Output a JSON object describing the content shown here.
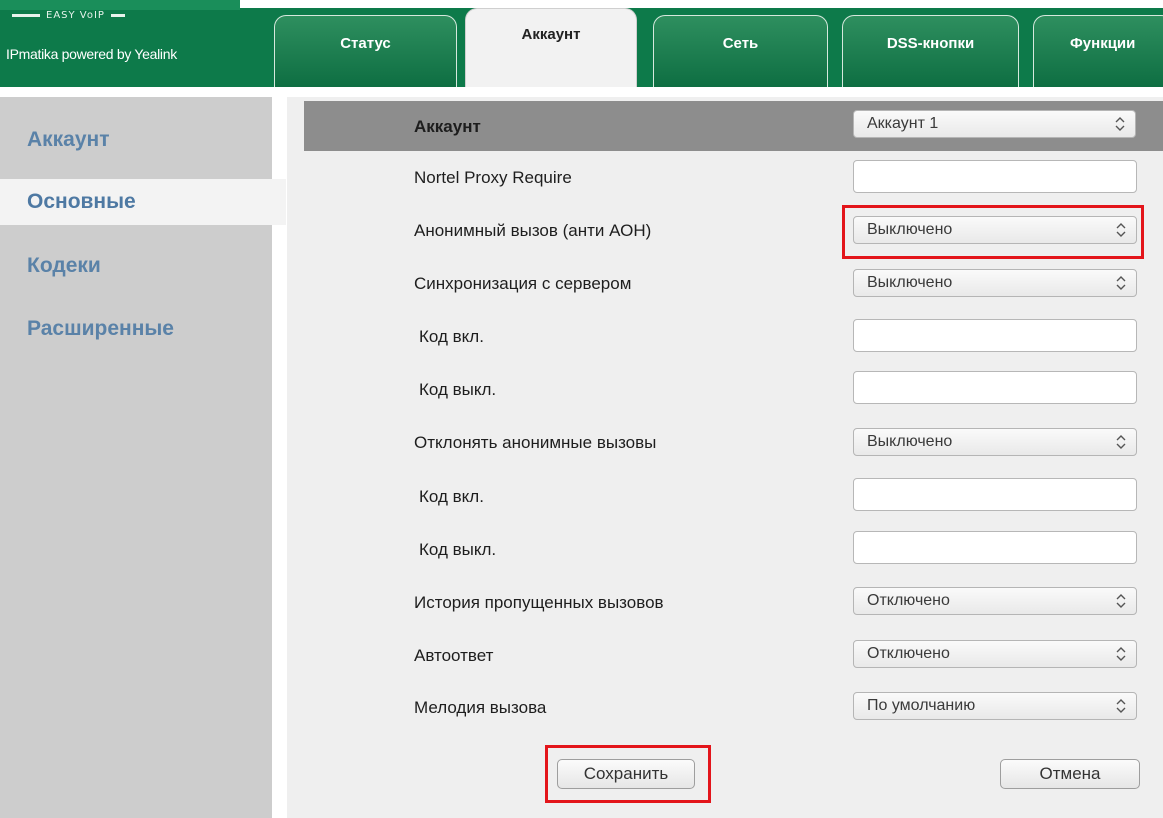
{
  "header": {
    "logo_text": "EASY VoIP",
    "brand": "IPmatika powered by Yealink",
    "tabs": [
      {
        "label": "Статус"
      },
      {
        "label": "Аккаунт"
      },
      {
        "label": "Сеть"
      },
      {
        "label": "DSS-кнопки"
      },
      {
        "label": "Функции"
      }
    ],
    "active_tab": "Аккаунт"
  },
  "sidebar": {
    "items": [
      {
        "label": "Аккаунт"
      },
      {
        "label": "Основные"
      },
      {
        "label": "Кодеки"
      },
      {
        "label": "Расширенные"
      }
    ],
    "selected": "Основные"
  },
  "form": {
    "header": {
      "label": "Аккаунт",
      "selected_account": "Аккаунт 1"
    },
    "rows": [
      {
        "label": "Nortel Proxy Require",
        "type": "text",
        "value": ""
      },
      {
        "label": "Анонимный вызов (анти АОН)",
        "type": "select",
        "value": "Выключено"
      },
      {
        "label": "Синхронизация с сервером",
        "type": "select",
        "value": "Выключено"
      },
      {
        "label": "Код вкл.",
        "type": "text",
        "value": ""
      },
      {
        "label": "Код выкл.",
        "type": "text",
        "value": ""
      },
      {
        "label": "Отклонять анонимные вызовы",
        "type": "select",
        "value": "Выключено"
      },
      {
        "label": "Код вкл.",
        "type": "text",
        "value": ""
      },
      {
        "label": "Код выкл.",
        "type": "text",
        "value": ""
      },
      {
        "label": "История пропущенных вызовов",
        "type": "select",
        "value": "Отключено"
      },
      {
        "label": "Автоответ",
        "type": "select",
        "value": "Отключено"
      },
      {
        "label": "Мелодия вызова",
        "type": "select",
        "value": "По умолчанию"
      }
    ]
  },
  "buttons": {
    "save": "Сохранить",
    "cancel": "Отмена"
  },
  "colors": {
    "header_green": "#0d7a4a",
    "highlight_red": "#e3151b",
    "sidebar_link": "#5a82a8"
  }
}
